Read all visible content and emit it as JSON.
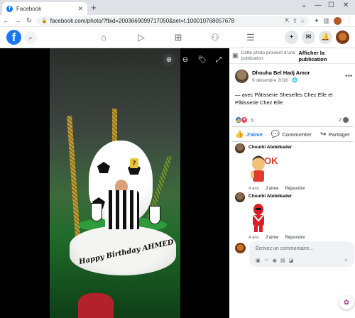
{
  "browser": {
    "tab_title": "Facebook",
    "tab_favicon": "f",
    "url": "facebook.com/photo/?fbid=2003669099717050&set=t.100010768057678",
    "new_tab": "+",
    "window_controls": [
      "⌄",
      "—",
      "☐",
      "✕"
    ]
  },
  "fb_header": {
    "logo": "f",
    "nav_icons": [
      "home-icon",
      "watch-icon",
      "marketplace-icon",
      "groups-icon",
      "menu-icon"
    ]
  },
  "notice": {
    "text": "Cette photo provient d’une publication.",
    "link": "Afficher la publication"
  },
  "post": {
    "author": "Dhouha Bel Hadj Amor",
    "date": "9 décembre 2018 · ",
    "caption": "— avec Pâtisserie Sheselles Chez Elle et Pâtisserie Chez Elle.",
    "reaction_count": "5",
    "comment_count": "2",
    "actions": {
      "like": "J’aime",
      "comment": "Commenter",
      "share": "Partager"
    }
  },
  "comments": [
    {
      "name": "Chouihi Abdelkader",
      "age": "4 ans",
      "like": "J’aime",
      "reply": "Répondre",
      "sticker_text": "OK!"
    },
    {
      "name": "Chouihi Abdelkader",
      "age": "4 ans",
      "like": "J’aime",
      "reply": "Répondre",
      "sticker_text": ""
    }
  ],
  "composer": {
    "placeholder": "Écrivez un commentaire…"
  },
  "cake_text": "Happy Birthday AHMED",
  "colors": {
    "fb_blue": "#1877f2",
    "love_red": "#f33e58"
  }
}
